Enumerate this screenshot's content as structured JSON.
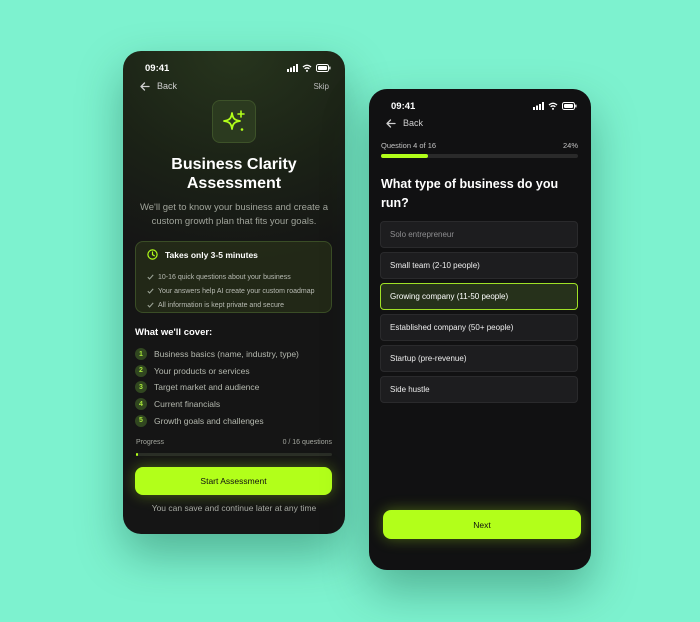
{
  "colors": {
    "background": "#7df2cf",
    "accent": "#b2ff1a",
    "phone_bg": "#151515"
  },
  "screen1": {
    "time": "09:41",
    "back_label": "Back",
    "skip_label": "Skip",
    "hero_icon": "sparkles-icon",
    "title_line1": "Business Clarity",
    "title_line2": "Assessment",
    "subtitle_line1": "We'll get to know your business and create a",
    "subtitle_line2": "custom growth plan that fits your goals.",
    "info": {
      "heading": "Takes only 3-5 minutes",
      "items": [
        "10-16 quick questions about your business",
        "Your answers help AI create your custom roadmap",
        "All information is kept private and secure"
      ]
    },
    "cover_title": "What we'll cover:",
    "cover_items": [
      {
        "num": "1",
        "label": "Business basics (name, industry, type)"
      },
      {
        "num": "2",
        "label": "Your products or services"
      },
      {
        "num": "3",
        "label": "Target market and audience"
      },
      {
        "num": "4",
        "label": "Current financials"
      },
      {
        "num": "5",
        "label": "Growth goals and challenges"
      }
    ],
    "progress_label": "Progress",
    "progress_value": "0 / 16 questions",
    "progress_fraction": 0,
    "start_button": "Start Assessment",
    "save_note": "You can save and continue later at any time"
  },
  "screen2": {
    "time": "09:41",
    "back_label": "Back",
    "question_counter": "Question 4 of 16",
    "percent": "24%",
    "progress_fraction": 0.24,
    "question_line1": "What type of business do you",
    "question_line2": "run?",
    "options": [
      "Solo entrepreneur",
      "Small team (2-10 people)",
      "Growing company (11-50 people)",
      "Established company (50+ people)",
      "Startup (pre-revenue)",
      "Side hustle"
    ],
    "selected_option": "Growing company (11-50 people)",
    "next_button": "Next"
  }
}
